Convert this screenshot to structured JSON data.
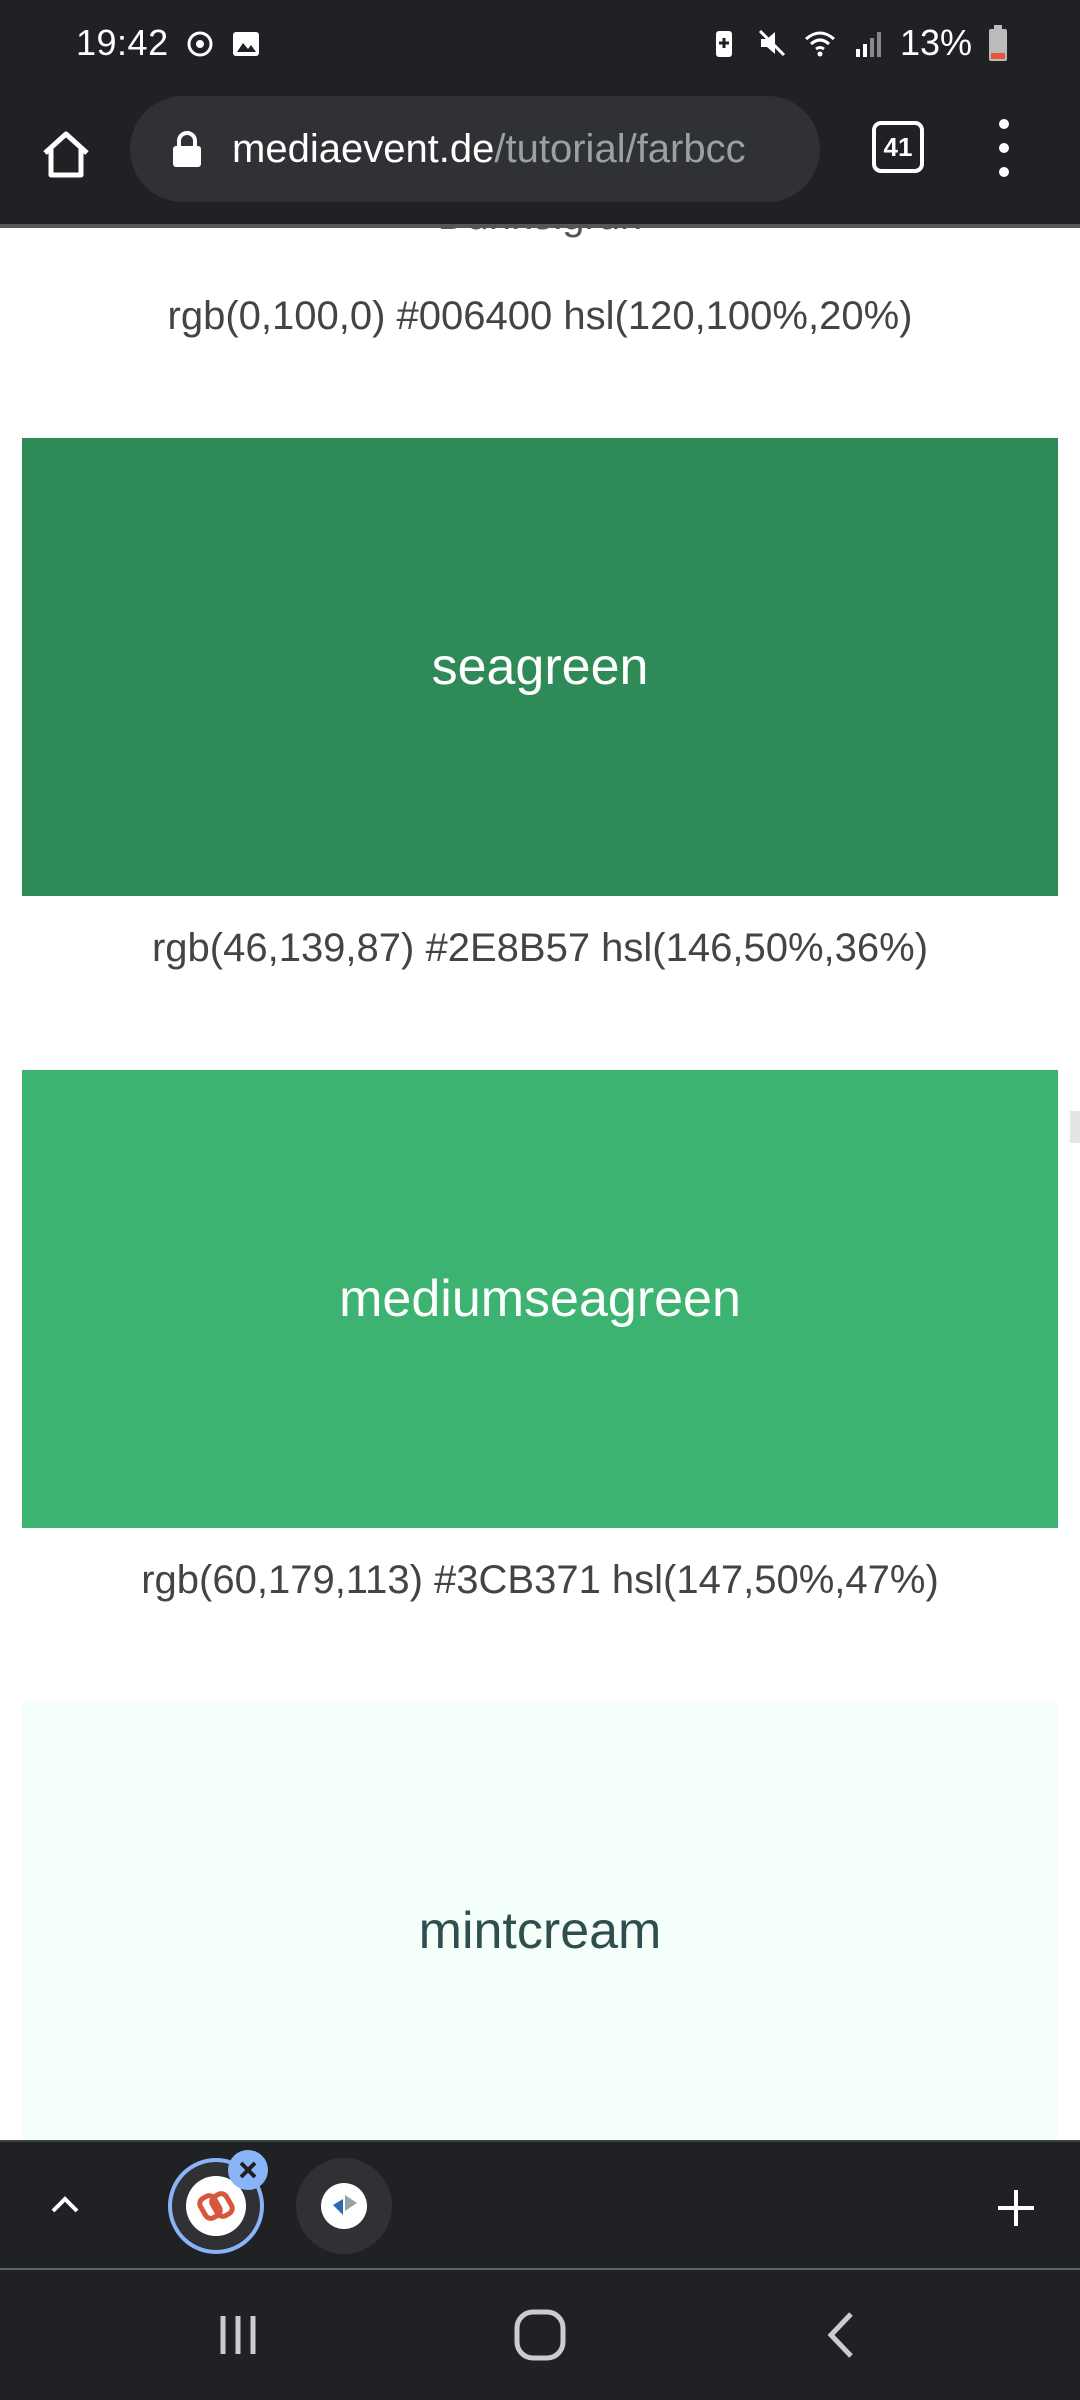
{
  "status_bar": {
    "time": "19:42",
    "battery_percent": "13%",
    "icons": [
      "sync-icon",
      "image-icon",
      "battery-saver-icon",
      "mute-icon",
      "wifi-icon",
      "signal-icon",
      "battery-icon"
    ]
  },
  "toolbar": {
    "url_domain": "mediaevent.de",
    "url_path": "/tutorial/farbcc",
    "tab_count": "41"
  },
  "page": {
    "clipped_heading": "Dunkelgrün",
    "items": [
      {
        "name": "",
        "info": "rgb(0,100,0) #006400 hsl(120,100%,20%)",
        "bg": "#006400",
        "fg": "#ffffff"
      },
      {
        "name": "seagreen",
        "info": "rgb(46,139,87) #2E8B57 hsl(146,50%,36%)",
        "bg": "#2E8B57",
        "fg": "#ffffff"
      },
      {
        "name": "mediumseagreen",
        "info": "rgb(60,179,113) #3CB371 hsl(147,50%,47%)",
        "bg": "#3CB371",
        "fg": "#ffffff"
      },
      {
        "name": "mintcream",
        "info": "",
        "bg": "#F5FFFA",
        "fg": "#2F4F4F"
      }
    ]
  },
  "colors": {
    "chrome_bg": "#202124",
    "url_pill_bg": "#303134",
    "accent_blue": "#8ab4f8"
  }
}
